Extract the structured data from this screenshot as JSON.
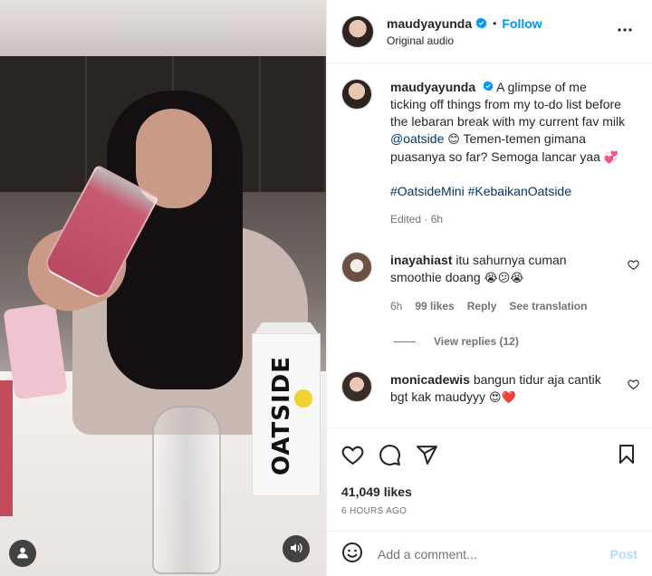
{
  "post": {
    "username": "maudyayunda",
    "follow_label": "Follow",
    "separator": "•",
    "audio_label": "Original audio",
    "caption_text": "A glimpse of me ticking off things from my to-do list before the lebaran break with my current fav milk",
    "caption_mention": "@oatside",
    "caption_emoji": "😊",
    "caption_text_2": "Temen-temen gimana puasanya so far? Semoga lancar yaa",
    "caption_emoji_2": "💞",
    "hashtag_1": "#OatsideMini",
    "hashtag_2": "#KebaikanOatside",
    "edited_label": "Edited · 6h",
    "likes": "41,049 likes",
    "timestamp": "6 HOURS AGO"
  },
  "comments": [
    {
      "username": "inayahiast",
      "text": "itu sahurnya cuman smoothie doang",
      "emojis": "😭😕😭",
      "time": "6h",
      "likes": "99 likes",
      "reply_label": "Reply",
      "translate_label": "See translation",
      "view_replies": "View replies (12)"
    },
    {
      "username": "monicadewis",
      "text": "bangun tidur aja cantik bgt kak maudyyy",
      "emojis": "😍❤️"
    }
  ],
  "composer": {
    "placeholder": "Add a comment...",
    "post_label": "Post"
  },
  "media": {
    "carton_text": "OATSIDE"
  },
  "icons": {
    "verified": "verified-badge-icon",
    "more": "more-options-icon",
    "heart": "heart-icon",
    "comment": "comment-icon",
    "share": "share-icon",
    "save": "bookmark-icon",
    "emoji": "emoji-icon",
    "user_tag": "user-tag-icon",
    "audio": "audio-icon"
  },
  "colors": {
    "accent": "#0095f6",
    "link": "#00376b",
    "post_disabled": "#b3dbff",
    "muted": "#737373"
  }
}
